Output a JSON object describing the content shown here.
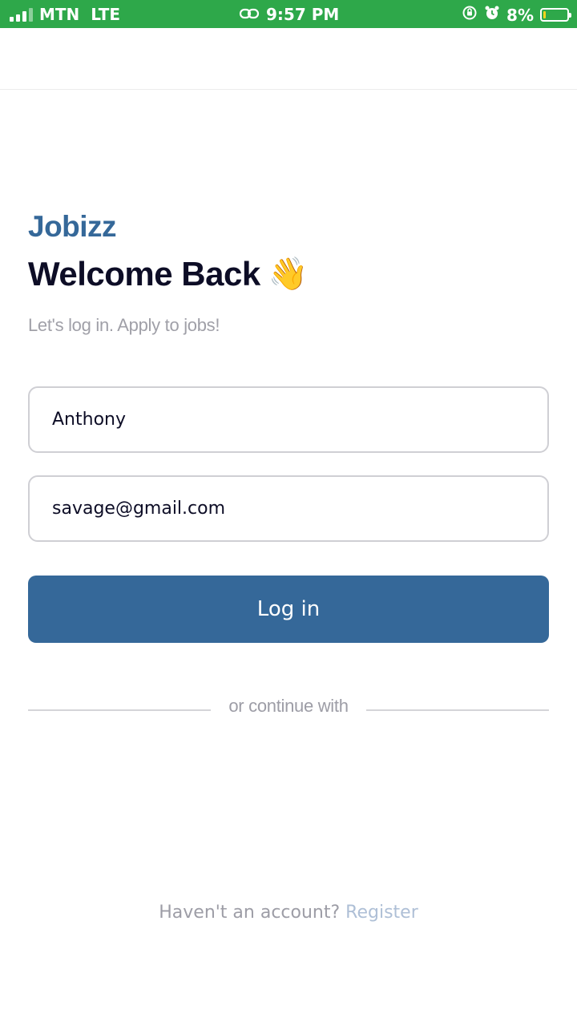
{
  "status_bar": {
    "carrier": "MTN",
    "network": "LTE",
    "time": "9:57 PM",
    "battery_percent": "8%",
    "battery_level": 0.08,
    "background_color": "#2ea84a",
    "icons": [
      "signal-icon",
      "link-icon",
      "orientation-lock-icon",
      "alarm-icon",
      "battery-icon"
    ]
  },
  "brand": {
    "name": "Jobizz",
    "color": "#356899"
  },
  "header": {
    "title": "Welcome Back",
    "emoji": "👋",
    "subtitle": "Let's log in. Apply to jobs!"
  },
  "form": {
    "username_value": "Anthony",
    "email_value": "savage@gmail.com",
    "login_label": "Log in",
    "button_color": "#356899"
  },
  "divider": {
    "text": "or continue with"
  },
  "footer": {
    "prompt": "Haven't an account?",
    "register_label": "Register"
  }
}
